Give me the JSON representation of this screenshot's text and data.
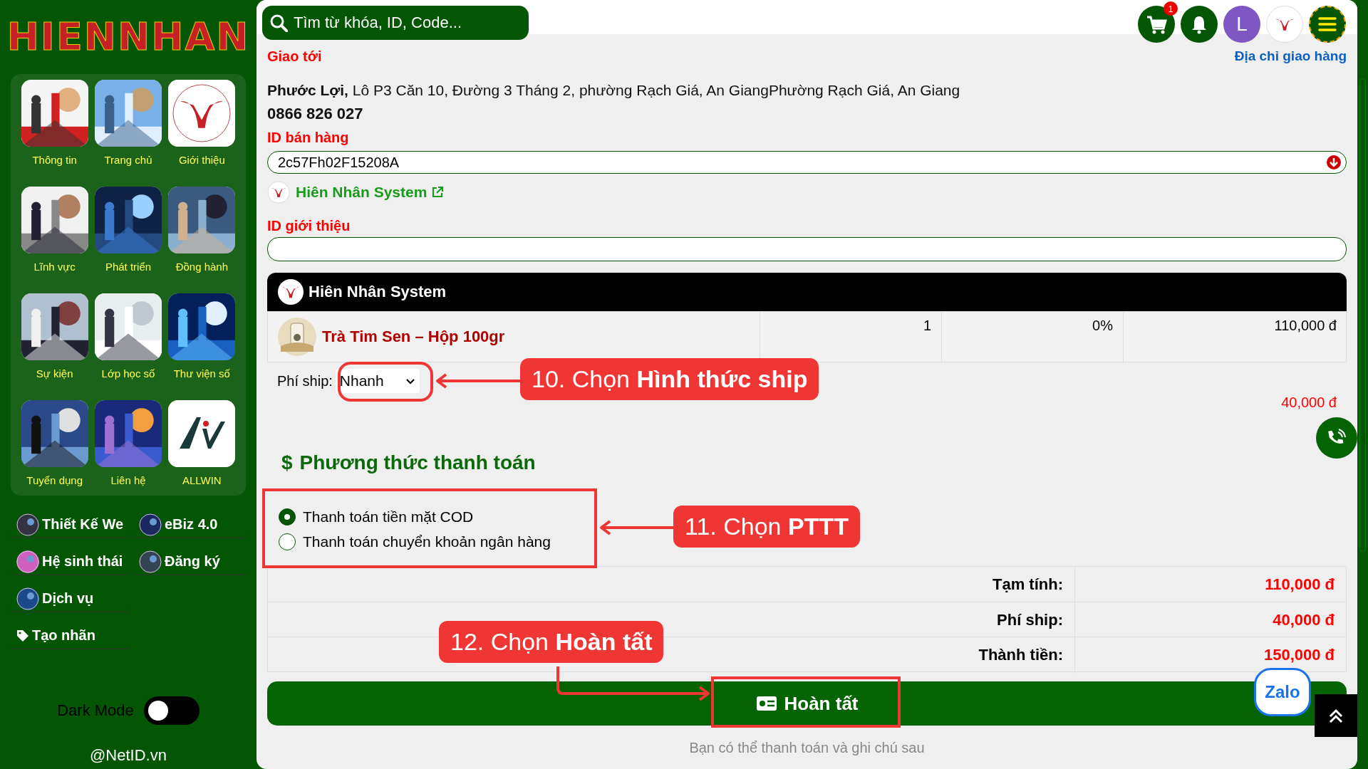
{
  "sidebar": {
    "logo": "HIENNHAN",
    "tiles": [
      {
        "label": "Thông tin",
        "kind": "picture"
      },
      {
        "label": "Trang chủ",
        "kind": "picture"
      },
      {
        "label": "Giới thiệu",
        "kind": "logo"
      },
      {
        "label": "Lĩnh vực",
        "kind": "picture"
      },
      {
        "label": "Phát triển",
        "kind": "picture"
      },
      {
        "label": "Đồng hành",
        "kind": "picture"
      },
      {
        "label": "Sự kiện",
        "kind": "picture"
      },
      {
        "label": "Lớp học số",
        "kind": "picture"
      },
      {
        "label": "Thư viện số",
        "kind": "picture"
      },
      {
        "label": "Tuyển dụng",
        "kind": "picture"
      },
      {
        "label": "Liên hệ",
        "kind": "picture"
      },
      {
        "label": "ALLWIN",
        "kind": "logo"
      }
    ],
    "links": [
      {
        "label": "Thiết Kế We",
        "kind": "avatar"
      },
      {
        "label": "eBiz 4.0",
        "kind": "avatar"
      },
      {
        "label": "Hệ sinh thái",
        "kind": "avatar"
      },
      {
        "label": "Đăng ký",
        "kind": "avatar"
      },
      {
        "label": "Dịch vụ",
        "kind": "avatar"
      },
      {
        "label": "Tạo nhãn",
        "kind": "tag"
      }
    ],
    "dark_mode": {
      "label": "Dark Mode",
      "on": false
    },
    "footer": "@NetID.vn"
  },
  "header": {
    "search": {
      "placeholder": "Tìm từ khóa, ID, Code..."
    },
    "cart_count": "1",
    "avatar": "L"
  },
  "delivery": {
    "label": "Giao tới",
    "address_link": "Địa chỉ giao hàng",
    "name": "Phước Lợi,",
    "address": "Lô P3 Căn 10, Đường 3 Tháng 2, phường Rạch Giá, An GiangPhường Rạch Giá, An Giang",
    "phone": "0866 826 027"
  },
  "seller": {
    "label": "ID bán hàng",
    "value": "2c57Fh02F15208A",
    "shop": "Hiên Nhân System"
  },
  "referrer": {
    "label": "ID giới thiệu"
  },
  "order": {
    "shop": "Hiên Nhân System",
    "items": [
      {
        "name": "Trà Tim Sen – Hộp 100gr",
        "quantity": "1",
        "discount": "0%",
        "price": "110,000 đ"
      }
    ],
    "ship_label": "Phí ship:",
    "ship_method": "Nhanh",
    "ship_fee": "40,000 đ"
  },
  "payment": {
    "title": "Phương thức thanh toán",
    "icon": "$",
    "options": [
      {
        "label": "Thanh toán tiền mặt COD",
        "selected": true
      },
      {
        "label": "Thanh toán chuyển khoản ngân hàng",
        "selected": false
      }
    ]
  },
  "summary": [
    {
      "label": "Tạm tính:",
      "value": "110,000 đ"
    },
    {
      "label": "Phí ship:",
      "value": "40,000 đ"
    },
    {
      "label": "Thành tiền:",
      "value": "150,000 đ"
    }
  ],
  "submit": {
    "label": "Hoàn tất",
    "note": "Bạn có thể thanh toán và ghi chú sau"
  },
  "annotations": [
    {
      "text": "10. Chọn **Hình thức ship**"
    },
    {
      "text": "11. Chọn **PTTT**"
    },
    {
      "text": "12. Chọn **Hoàn tất**"
    }
  ],
  "floating": {
    "zalo": "Zalo"
  }
}
